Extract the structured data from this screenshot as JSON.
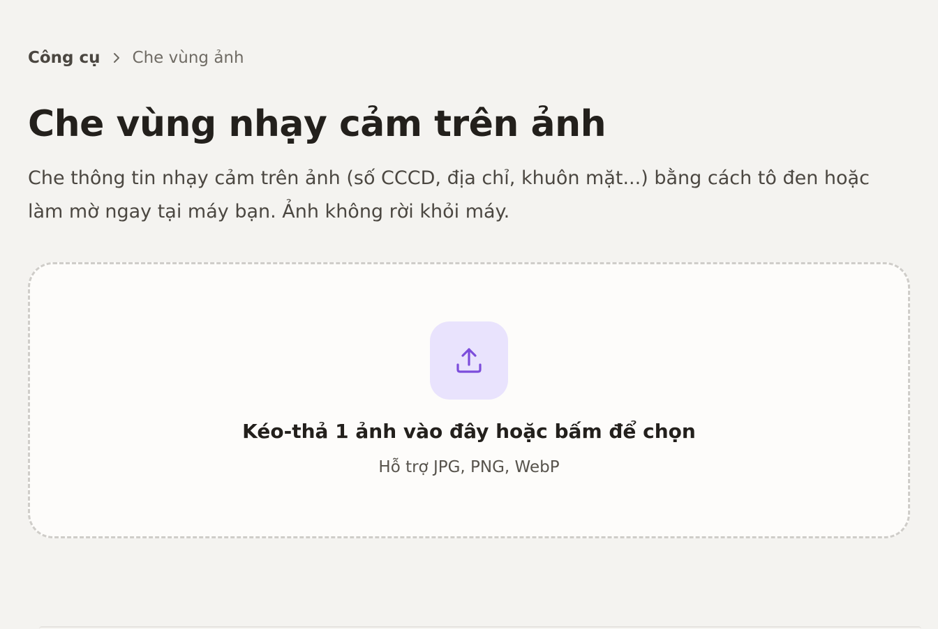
{
  "breadcrumb": {
    "root": "Công cụ",
    "current": "Che vùng ảnh"
  },
  "page": {
    "title": "Che vùng nhạy cảm trên ảnh",
    "description": "Che thông tin nhạy cảm trên ảnh (số CCCD, địa chỉ, khuôn mặt...) bằng cách tô đen hoặc làm mờ ngay tại máy bạn. Ảnh không rời khỏi máy."
  },
  "dropzone": {
    "icon": "upload-icon",
    "title": "Kéo-thả 1 ảnh vào đây hoặc bấm để chọn",
    "hint": "Hỗ trợ JPG, PNG, WebP"
  },
  "colors": {
    "background": "#f4f3f0",
    "accent": "#7c4ddb",
    "accent_soft": "#e9e3fd",
    "text_primary": "#23201c",
    "text_secondary": "#4b4741"
  }
}
